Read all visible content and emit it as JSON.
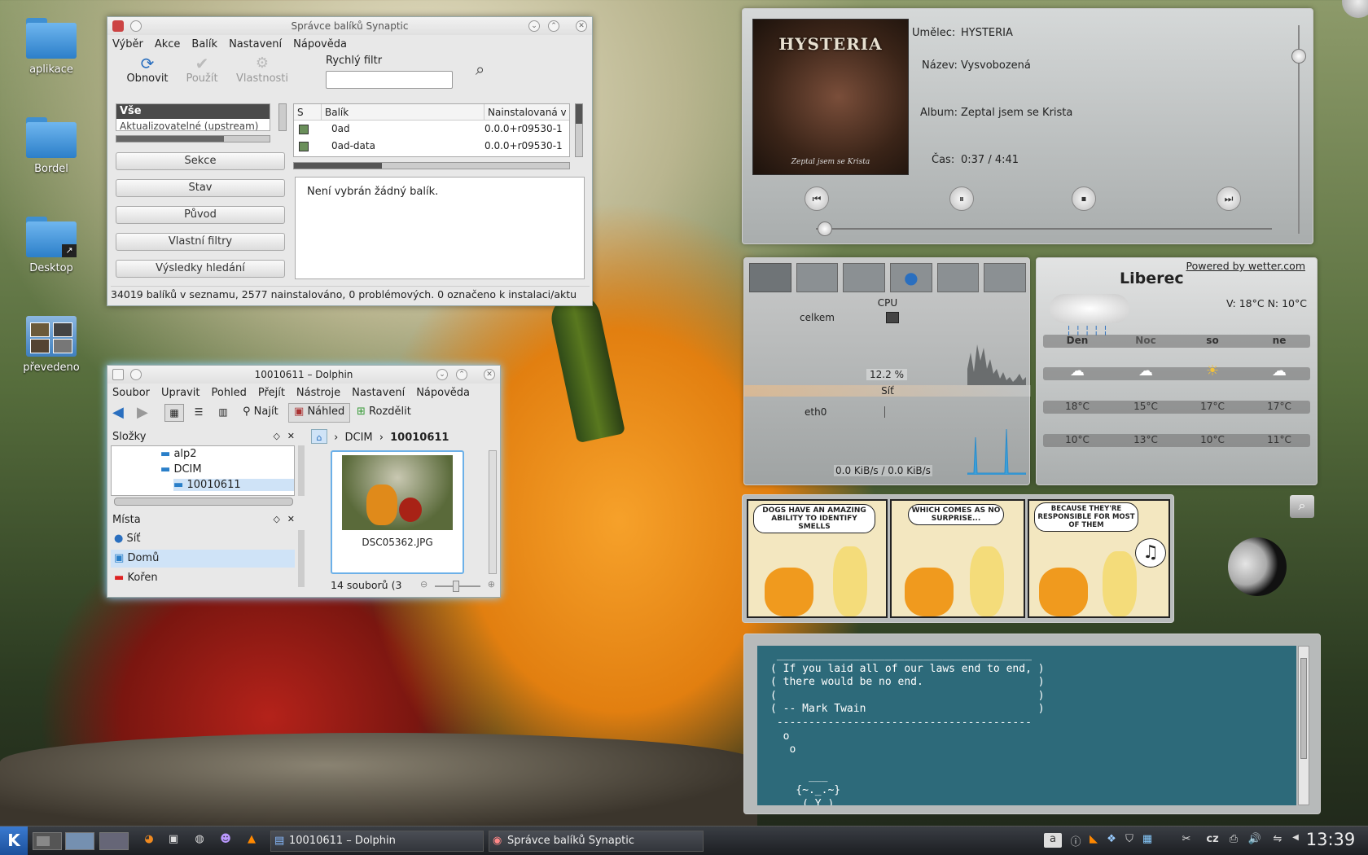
{
  "desktop": {
    "icons": [
      {
        "label": "aplikace"
      },
      {
        "label": "Bordel"
      },
      {
        "label": "Desktop"
      },
      {
        "label": "převedeno"
      }
    ]
  },
  "synaptic": {
    "title": "Správce balíků Synaptic",
    "menu": [
      "Výběr",
      "Akce",
      "Balík",
      "Nastavení",
      "Nápověda"
    ],
    "toolbar": {
      "refresh": "Obnovit",
      "apply": "Použít",
      "properties": "Vlastnosti",
      "filter_label": "Rychlý filtr",
      "filter_value": ""
    },
    "filters": [
      "Vše",
      "Aktualizovatelné (upstream)"
    ],
    "nav_buttons": [
      "Sekce",
      "Stav",
      "Původ",
      "Vlastní filtry",
      "Výsledky hledání"
    ],
    "columns": [
      "S",
      "Balík",
      "Nainstalovaná v"
    ],
    "rows": [
      {
        "name": "0ad",
        "version": "0.0.0+r09530-1"
      },
      {
        "name": "0ad-data",
        "version": "0.0.0+r09530-1"
      }
    ],
    "description": "Není vybrán žádný balík.",
    "status": "34019 balíků v seznamu, 2577 nainstalováno, 0 problémových. 0 označeno k instalaci/aktu"
  },
  "dolphin": {
    "title": "10010611 – Dolphin",
    "menu": [
      "Soubor",
      "Upravit",
      "Pohled",
      "Přejít",
      "Nástroje",
      "Nastavení",
      "Nápověda"
    ],
    "toolbar": {
      "find": "Najít",
      "preview": "Náhled",
      "split": "Rozdělit"
    },
    "folders_title": "Složky",
    "tree": [
      "alp2",
      "DCIM",
      "10010611"
    ],
    "breadcrumb": [
      "DCIM",
      "10010611"
    ],
    "places_title": "Místa",
    "places": [
      "Síť",
      "Domů",
      "Kořen"
    ],
    "file": "DSC05362.JPG",
    "status": "14 souborů (3"
  },
  "player": {
    "artist_label": "Umělec:",
    "artist": "HYSTERIA",
    "title_label": "Název:",
    "title": "Vysvobozená",
    "album_label": "Album:",
    "album": "Zeptal jsem se Krista",
    "time_label": "Čas:",
    "time": "0:37 / 4:41",
    "cover_text": "HYSTERIA",
    "cover_subtext": "Zeptal jsem se Krista",
    "progress": 0.02,
    "volume": 0.85,
    "colors": {
      "album_art": "#3a2418"
    }
  },
  "sysmon": {
    "cpu_title": "CPU",
    "cpu_label": "celkem",
    "cpu_value": "12.2 %",
    "net_title": "Síť",
    "net_label": "eth0",
    "net_value": "0.0 KiB/s / 0.0 KiB/s"
  },
  "weather": {
    "powered": "Powered by wetter.com",
    "city": "Liberec",
    "hilo": "V: 18°C N: 10°C",
    "days": [
      "Den",
      "Noc",
      "so",
      "ne"
    ],
    "highs": [
      "18°C",
      "15°C",
      "17°C",
      "17°C"
    ],
    "lows": [
      "10°C",
      "13°C",
      "10°C",
      "11°C"
    ]
  },
  "comic": {
    "panel1": "DOGS HAVE AN AMAZING ABILITY TO IDENTIFY SMELLS",
    "panel2": "WHICH COMES AS NO SURPRISE...",
    "panel3": "BECAUSE THEY'RE RESPONSIBLE FOR MOST OF THEM"
  },
  "terminal": {
    "lines": [
      " ________________________________________",
      "( If you laid all of our laws end to end, )",
      "( there would be no end.                  )",
      "(                                         )",
      "( -- Mark Twain                           )",
      " ----------------------------------------",
      "  o",
      "   o",
      "",
      "      ___",
      "    {~._.~}",
      "     ( Y )"
    ]
  },
  "taskbar": {
    "tasks": [
      "10010611 – Dolphin",
      "Správce balíků Synaptic"
    ],
    "layout": "cz",
    "clock": "13:39"
  }
}
